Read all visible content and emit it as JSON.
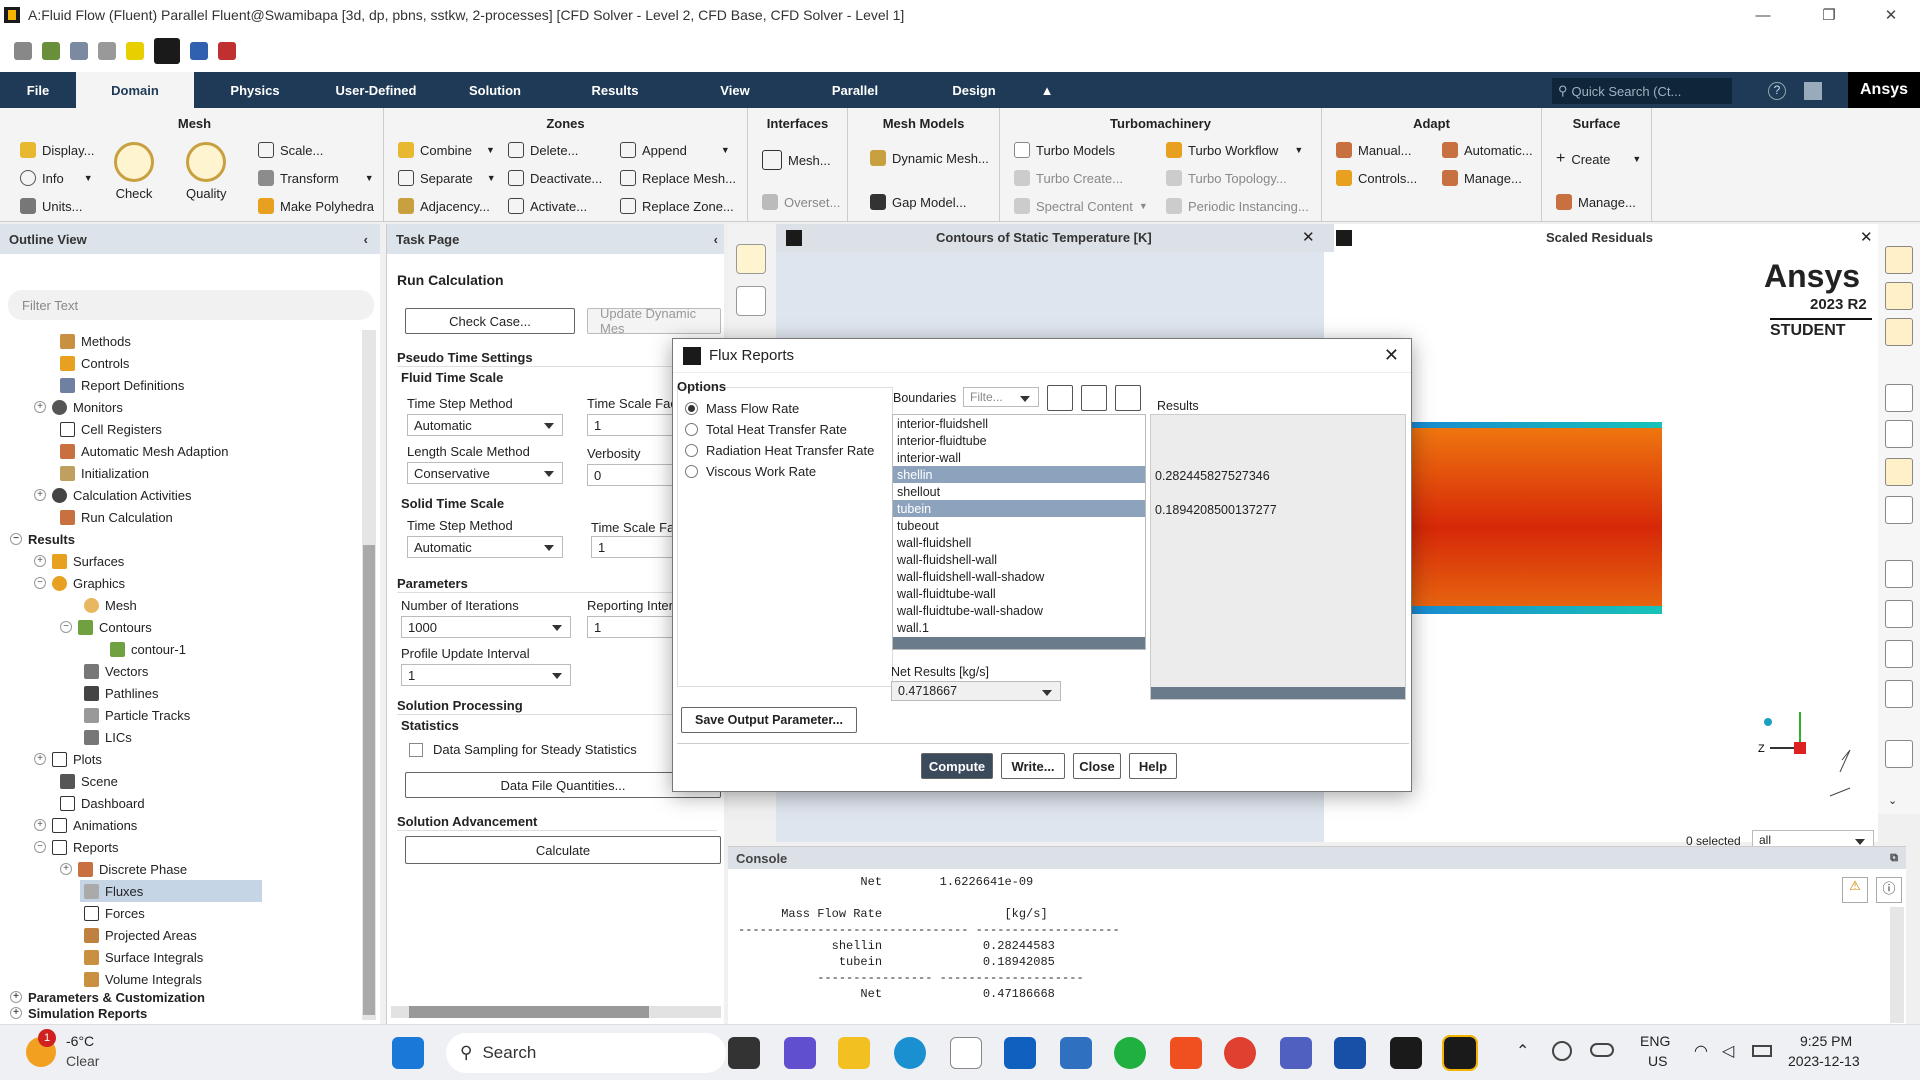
{
  "window": {
    "title": "A:Fluid Flow (Fluent) Parallel Fluent@Swamibapa  [3d, dp, pbns, sstkw, 2-processes] [CFD Solver - Level 2, CFD Base, CFD Solver - Level 1]",
    "min": "—",
    "max": "❐",
    "close": "✕"
  },
  "tabs": [
    "File",
    "Domain",
    "Physics",
    "User-Defined",
    "Solution",
    "Results",
    "View",
    "Parallel",
    "Design"
  ],
  "search": {
    "placeholder": "Quick Search (Ct..."
  },
  "brand": "Ansys",
  "ribbon": {
    "mesh": {
      "title": "Mesh",
      "display": "Display...",
      "info": "Info",
      "units": "Units...",
      "check": "Check",
      "quality": "Quality",
      "scale": "Scale...",
      "transform": "Transform",
      "polyhedra": "Make Polyhedra"
    },
    "zones": {
      "title": "Zones",
      "combine": "Combine",
      "separate": "Separate",
      "adjacency": "Adjacency...",
      "delete": "Delete...",
      "deactivate": "Deactivate...",
      "activate": "Activate...",
      "append": "Append",
      "replace_mesh": "Replace Mesh...",
      "replace_zone": "Replace Zone..."
    },
    "interfaces": {
      "title": "Interfaces",
      "mesh": "Mesh...",
      "overset": "Overset..."
    },
    "mesh_models": {
      "title": "Mesh Models",
      "dynamic": "Dynamic Mesh...",
      "gap": "Gap Model..."
    },
    "turbo": {
      "title": "Turbomachinery",
      "models": "Turbo Models",
      "create": "Turbo Create...",
      "spectral": "Spectral Content",
      "workflow": "Turbo Workflow",
      "topology": "Turbo Topology...",
      "periodic": "Periodic Instancing..."
    },
    "adapt": {
      "title": "Adapt",
      "manual": "Manual...",
      "controls": "Controls...",
      "automatic": "Automatic...",
      "manage": "Manage..."
    },
    "surface": {
      "title": "Surface",
      "create": "Create",
      "manage": "Manage..."
    }
  },
  "outline": {
    "title": "Outline View",
    "filter": "Filter Text",
    "items": [
      "Methods",
      "Controls",
      "Report Definitions",
      "Monitors",
      "Cell Registers",
      "Automatic Mesh Adaption",
      "Initialization",
      "Calculation Activities",
      "Run Calculation",
      "Results",
      "Surfaces",
      "Graphics",
      "Mesh",
      "Contours",
      "contour-1",
      "Vectors",
      "Pathlines",
      "Particle Tracks",
      "LICs",
      "Plots",
      "Scene",
      "Dashboard",
      "Animations",
      "Reports",
      "Discrete Phase",
      "Fluxes",
      "Forces",
      "Projected Areas",
      "Surface Integrals",
      "Volume Integrals",
      "Parameters & Customization",
      "Simulation Reports"
    ]
  },
  "task": {
    "title": "Task Page",
    "heading": "Run Calculation",
    "check_case": "Check Case...",
    "update_mesh": "Update Dynamic Mes",
    "pseudo": "Pseudo Time Settings",
    "fluid_ts": "Fluid Time Scale",
    "tsm": "Time Step Method",
    "tsm_val": "Automatic",
    "tsf": "Time Scale Fact",
    "tsf_val": "1",
    "lsm": "Length Scale Method",
    "lsm_val": "Conservative",
    "verbosity": "Verbosity",
    "verbosity_val": "0",
    "solid_ts": "Solid Time Scale",
    "stsm": "Time Step Method",
    "stsm_val": "Automatic",
    "stsf": "Time Scale Fac",
    "stsf_val": "1",
    "parameters": "Parameters",
    "niter": "Number of Iterations",
    "niter_val": "1000",
    "rint": "Reporting Inter",
    "rint_val": "1",
    "pui": "Profile Update Interval",
    "pui_val": "1",
    "processing": "Solution Processing",
    "statistics": "Statistics",
    "sampling": "Data Sampling for Steady Statistics",
    "dfq": "Data File Quantities...",
    "advancement": "Solution Advancement",
    "calculate": "Calculate"
  },
  "graphics": {
    "contour_title": "Contours of Static Temperature [K]",
    "residual_title": "Scaled Residuals",
    "ansys": "Ansys",
    "version": "2023 R2",
    "edition": "STUDENT",
    "selected": "0 selected",
    "filter_val": "all"
  },
  "dialog": {
    "title": "Flux Reports",
    "options_label": "Options",
    "options": [
      "Mass Flow Rate",
      "Total Heat Transfer Rate",
      "Radiation Heat Transfer Rate",
      "Viscous Work Rate"
    ],
    "boundaries_label": "Boundaries",
    "boundaries_filter": "Filte...",
    "boundaries": [
      "interior-fluidshell",
      "interior-fluidtube",
      "interior-wall",
      "shellin",
      "shellout",
      "tubein",
      "tubeout",
      "wall-fluidshell",
      "wall-fluidshell-wall",
      "wall-fluidshell-wall-shadow",
      "wall-fluidtube-wall",
      "wall-fluidtube-wall-shadow",
      "wall.1"
    ],
    "results_label": "Results",
    "result_1": "0.282445827527346",
    "result_2": "0.1894208500137277",
    "net_label": "Net Results [kg/s]",
    "net_val": "0.4718667",
    "save": "Save Output Parameter...",
    "compute": "Compute",
    "write": "Write...",
    "close": "Close",
    "help": "Help"
  },
  "console": {
    "title": "Console",
    "lines": [
      "                 Net        1.6226641e-09",
      "",
      "      Mass Flow Rate                 [kg/s]",
      "-------------------------------- --------------------",
      "             shellin              0.28244583",
      "              tubein              0.18942085",
      "           ---------------- --------------------",
      "                 Net              0.47186668"
    ]
  },
  "taskbar": {
    "temp": "-6°C",
    "weather": "Clear",
    "search": "Search",
    "lang": "ENG",
    "region": "US",
    "time": "9:25 PM",
    "date": "2023-12-13",
    "badge": "1"
  }
}
